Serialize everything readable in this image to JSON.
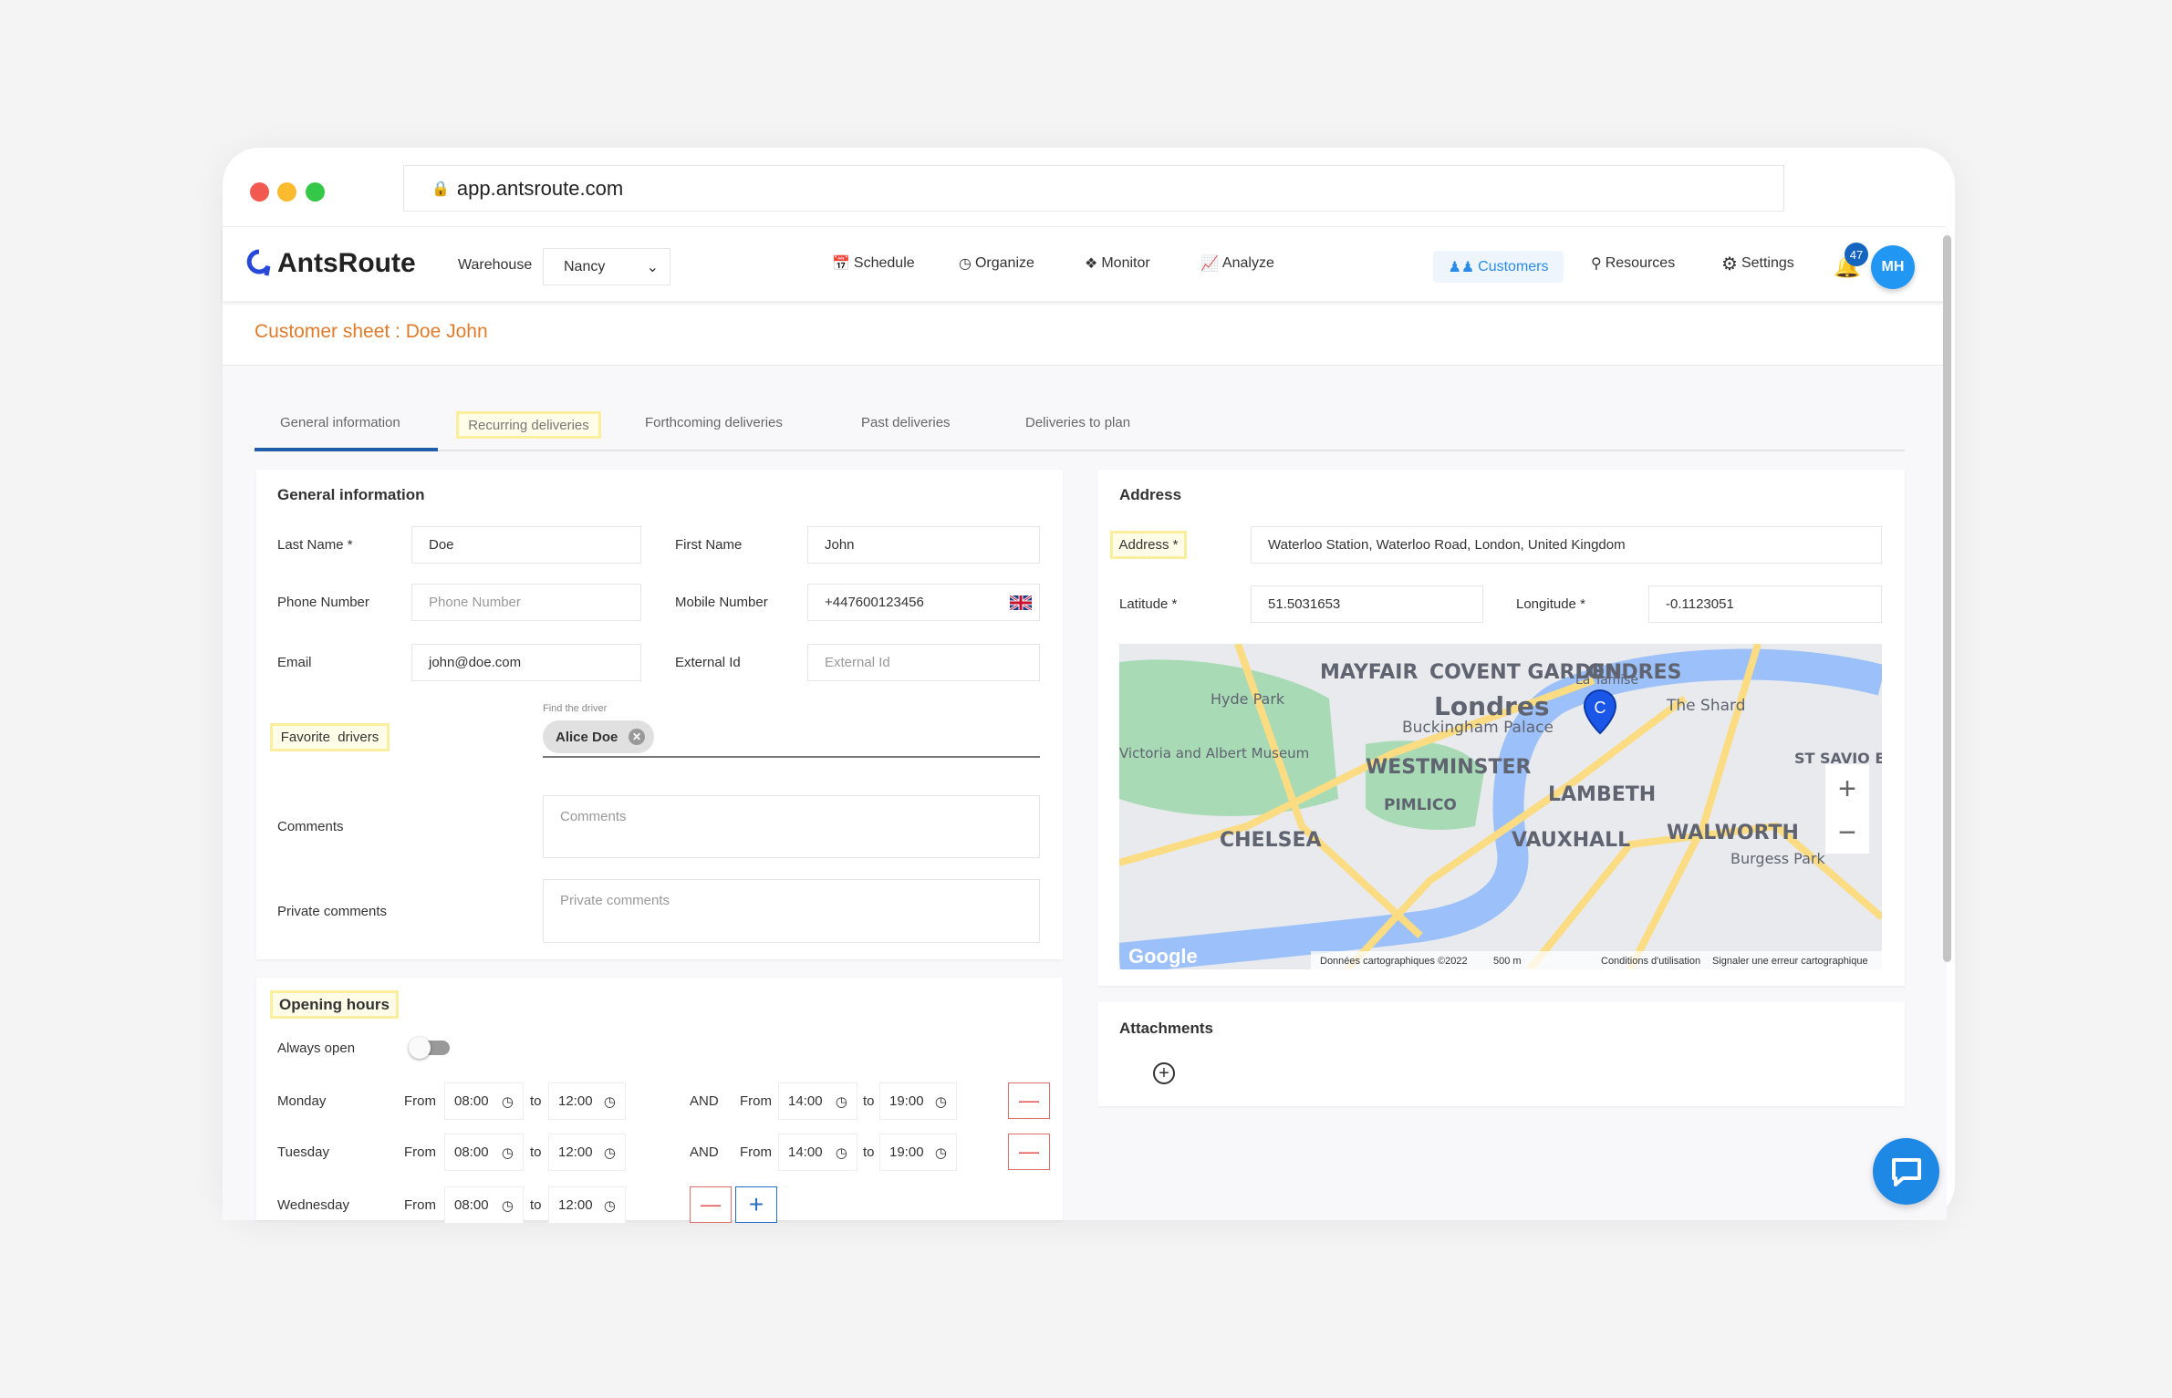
{
  "browser": {
    "url": "app.antsroute.com"
  },
  "nav": {
    "logo": "AntsRoute",
    "warehouse_label": "Warehouse",
    "warehouse_value": "Nancy",
    "items": [
      {
        "label": "Schedule",
        "icon": "calendar-icon"
      },
      {
        "label": "Organize",
        "icon": "gauge-icon"
      },
      {
        "label": "Monitor",
        "icon": "signpost-icon"
      },
      {
        "label": "Analyze",
        "icon": "chart-icon"
      }
    ],
    "right": [
      {
        "label": "Customers",
        "icon": "users-icon",
        "active": true
      },
      {
        "label": "Resources",
        "icon": "user-gear-icon"
      },
      {
        "label": "Settings",
        "icon": "gear-icon"
      }
    ],
    "notifications": "47",
    "avatar": "MH",
    "accent": "#2196f3"
  },
  "page": {
    "title": "Customer sheet : Doe John",
    "title_color": "#e07b2a"
  },
  "tabs": [
    {
      "label": "General information",
      "active": true
    },
    {
      "label": "Recurring deliveries",
      "highlighted": true
    },
    {
      "label": "Forthcoming deliveries"
    },
    {
      "label": "Past deliveries"
    },
    {
      "label": "Deliveries to plan"
    }
  ],
  "general": {
    "heading": "General information",
    "last_name": {
      "label": "Last Name *",
      "value": "Doe"
    },
    "first_name": {
      "label": "First Name",
      "value": "John"
    },
    "phone": {
      "label": "Phone Number",
      "placeholder": "Phone Number"
    },
    "mobile": {
      "label": "Mobile Number",
      "value": "+447600123456"
    },
    "email": {
      "label": "Email",
      "value": "john@doe.com"
    },
    "external_id": {
      "label": "External Id",
      "placeholder": "External Id"
    },
    "favorite": {
      "label": "Favorite  drivers",
      "find_label": "Find the driver",
      "chip": "Alice Doe"
    },
    "comments": {
      "label": "Comments",
      "placeholder": "Comments"
    },
    "private": {
      "label": "Private comments",
      "placeholder": "Private comments"
    }
  },
  "hours": {
    "heading": "Opening hours",
    "always_open": "Always open",
    "always_open_on": false,
    "from": "From",
    "to": "to",
    "and": "AND",
    "days": [
      {
        "day": "Monday",
        "slots": [
          [
            "08:00",
            "12:00"
          ],
          [
            "14:00",
            "19:00"
          ]
        ]
      },
      {
        "day": "Tuesday",
        "slots": [
          [
            "08:00",
            "12:00"
          ],
          [
            "14:00",
            "19:00"
          ]
        ]
      },
      {
        "day": "Wednesday",
        "slots": [
          [
            "08:00",
            "12:00"
          ]
        ]
      }
    ]
  },
  "address": {
    "heading": "Address",
    "address_label": "Address *",
    "address_value": "Waterloo Station, Waterloo Road, London, United Kingdom",
    "lat_label": "Latitude *",
    "lat_value": "51.5031653",
    "lng_label": "Longitude *",
    "lng_value": "-0.1123051",
    "map": {
      "labels": [
        "MAYFAIR",
        "COVENT GARDEN",
        "LONDRES",
        "Londres",
        "Hyde Park",
        "Buckingham Palace",
        "WESTMINSTER",
        "LAMBETH",
        "The Shard",
        "La Tamise",
        "PIMLICO",
        "CHELSEA",
        "VAUXHALL",
        "WALWORTH",
        "Burgess Park",
        "ST SAVIO ESTAT",
        "Victoria and Albert Museum"
      ],
      "marker": "C",
      "google": "Google",
      "attribution": "Données cartographiques ©2022",
      "scale": "500 m",
      "terms": "Conditions d'utilisation",
      "report": "Signaler une erreur cartographique"
    }
  },
  "attachments": {
    "heading": "Attachments"
  }
}
